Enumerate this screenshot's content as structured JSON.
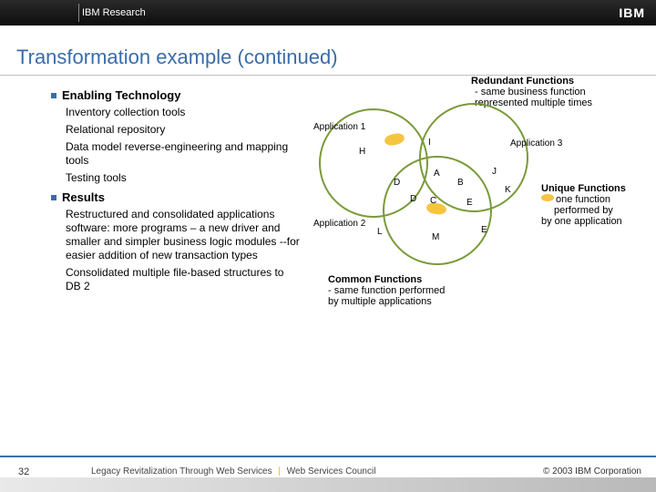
{
  "header": {
    "brand_area": "IBM Research",
    "logo_text": "IBM"
  },
  "title": "Transformation example (continued)",
  "left": {
    "section1": "Enabling Technology",
    "items1": [
      "Inventory collection tools",
      "Relational repository",
      "Data model reverse-engineering and mapping tools",
      "Testing tools"
    ],
    "section2": "Results",
    "items2": [
      "Restructured and consolidated applications software: more programs – a new driver and smaller and simpler business logic modules --for easier addition of new transaction types",
      "Consolidated multiple file-based structures to DB 2"
    ]
  },
  "redundant": {
    "title": "Redundant Functions",
    "desc": "- same business function represented multiple times"
  },
  "venn": {
    "app1": "Application 1",
    "app2": "Application 2",
    "app3": "Application 3",
    "labels": [
      "H",
      "I",
      "D",
      "A",
      "B",
      "J",
      "D",
      "C",
      "E",
      "K",
      "L",
      "M",
      "E"
    ]
  },
  "unique": {
    "title": "Unique Functions",
    "desc_l1": "one function",
    "desc_l2": "performed by",
    "desc_l3": "by one application"
  },
  "common": {
    "title": "Common Functions",
    "desc": "- same function performed by multiple applications"
  },
  "footer": {
    "page": "32",
    "text_a": "Legacy Revitalization Through Web Services",
    "text_b": "Web Services Council",
    "copyright": "© 2003 IBM Corporation"
  }
}
